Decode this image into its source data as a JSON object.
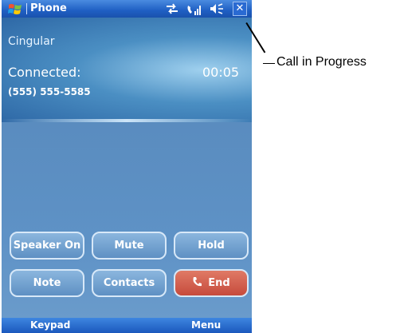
{
  "window": {
    "title": "Phone",
    "start_icon": "windows-flag-icon",
    "status_icons": [
      "connectivity-arrows-icon",
      "call-signal-icon",
      "speaker-icon"
    ],
    "close_label": "✕"
  },
  "call": {
    "carrier": "Cingular",
    "status": "Connected:",
    "timer": "00:05",
    "number": "(555) 555-5585"
  },
  "buttons": {
    "speaker": "Speaker On",
    "mute": "Mute",
    "hold": "Hold",
    "note": "Note",
    "contacts": "Contacts",
    "end": "End"
  },
  "softkeys": {
    "left": "Keypad",
    "right": "Menu"
  },
  "annotation": {
    "label": "Call in Progress"
  },
  "colors": {
    "title_bar": "#1f5fc3",
    "background": "#5c8fc2",
    "end_button": "#c64b3c"
  }
}
